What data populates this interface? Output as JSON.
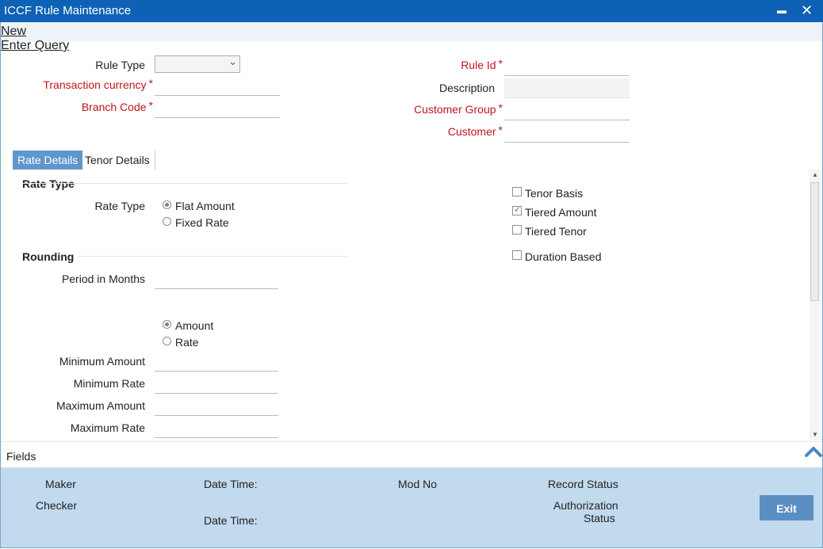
{
  "window": {
    "title": "ICCF Rule Maintenance",
    "minimize": "▬",
    "close": "✕"
  },
  "menu": {
    "new": "New",
    "enter_query": "Enter Query"
  },
  "header_fields": {
    "rule_type": {
      "label": "Rule Type",
      "value": ""
    },
    "transaction_currency": {
      "label": "Transaction currency",
      "value": ""
    },
    "branch_code": {
      "label": "Branch Code",
      "value": ""
    },
    "rule_id": {
      "label": "Rule Id",
      "value": ""
    },
    "description": {
      "label": "Description",
      "value": ""
    },
    "customer_group": {
      "label": "Customer Group",
      "value": ""
    },
    "customer": {
      "label": "Customer",
      "value": ""
    },
    "required_mark": "*"
  },
  "tabs": [
    {
      "label": "Rate Details",
      "active": true
    },
    {
      "label": "Tenor Details",
      "active": false
    }
  ],
  "rate_section": {
    "title": "Rate Type",
    "rate_type_label": "Rate Type",
    "options": [
      {
        "label": "Flat Amount",
        "selected": true
      },
      {
        "label": "Fixed Rate",
        "selected": false
      }
    ]
  },
  "checkboxes": [
    {
      "label": "Tenor Basis",
      "checked": false
    },
    {
      "label": "Tiered Amount",
      "checked": true
    },
    {
      "label": "Tiered Tenor",
      "checked": false
    },
    {
      "label": "Duration Based",
      "checked": false
    }
  ],
  "rounding_section": {
    "title": "Rounding",
    "period_label": "Period in Months",
    "period_value": "",
    "options": [
      {
        "label": "Amount",
        "selected": true
      },
      {
        "label": "Rate",
        "selected": false
      }
    ],
    "min_amount_label": "Minimum Amount",
    "min_rate_label": "Minimum Rate",
    "max_amount_label": "Maximum Amount",
    "max_rate_label": "Maximum Rate",
    "min_amount": "",
    "min_rate": "",
    "max_amount": "",
    "max_rate": ""
  },
  "fields_bar": {
    "label": "Fields"
  },
  "footer": {
    "maker": "Maker",
    "date_time_1": "Date Time:",
    "mod_no": "Mod No",
    "record_status": "Record Status",
    "checker": "Checker",
    "date_time_2": "Date Time:",
    "authorization": "Authorization",
    "status": "Status",
    "exit": "Exit"
  },
  "colors": {
    "titlebar": "#0e62b6",
    "required": "#c0141c",
    "tab_active": "#5f97cd",
    "footer": "#c2daee",
    "exit": "#5b8fc2"
  }
}
